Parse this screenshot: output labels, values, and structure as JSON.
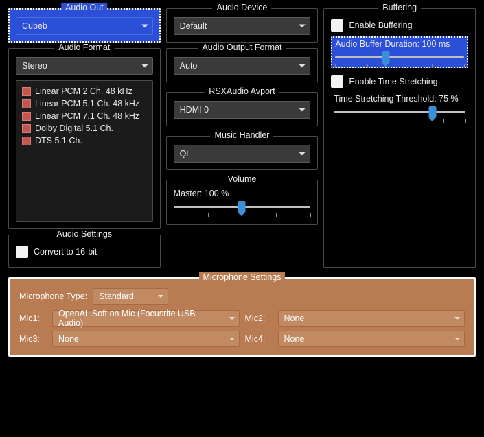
{
  "audio_out": {
    "legend": "Audio Out",
    "value": "Cubeb"
  },
  "audio_device": {
    "legend": "Audio Device",
    "value": "Default"
  },
  "audio_format": {
    "legend": "Audio Format",
    "value": "Stereo",
    "items": [
      "Linear PCM 2 Ch. 48 kHz",
      "Linear PCM 5.1 Ch. 48 kHz",
      "Linear PCM 7.1 Ch. 48 kHz",
      "Dolby Digital 5.1 Ch.",
      "DTS 5.1 Ch."
    ]
  },
  "audio_output_format": {
    "legend": "Audio Output Format",
    "value": "Auto"
  },
  "rsx_avport": {
    "legend": "RSXAudio Avport",
    "value": "HDMI 0"
  },
  "music_handler": {
    "legend": "Music Handler",
    "value": "Qt"
  },
  "volume": {
    "legend": "Volume",
    "label": "Master: 100 %",
    "percent": 50
  },
  "audio_settings": {
    "legend": "Audio Settings",
    "convert_label": "Convert to 16-bit"
  },
  "buffering": {
    "legend": "Buffering",
    "enable_buffering_label": "Enable Buffering",
    "buffer_duration_label": "Audio Buffer Duration: 100 ms",
    "buffer_duration_percent": 39,
    "enable_ts_label": "Enable Time Stretching",
    "ts_threshold_label": "Time Stretching Threshold: 75 %",
    "ts_threshold_percent": 75
  },
  "mic": {
    "legend": "Microphone Settings",
    "type_label": "Microphone Type:",
    "type_value": "Standard",
    "mic1_label": "Mic1:",
    "mic1_value": "OpenAL Soft on Mic (Focusrite USB Audio)",
    "mic2_label": "Mic2:",
    "mic2_value": "None",
    "mic3_label": "Mic3:",
    "mic3_value": "None",
    "mic4_label": "Mic4:",
    "mic4_value": "None"
  }
}
